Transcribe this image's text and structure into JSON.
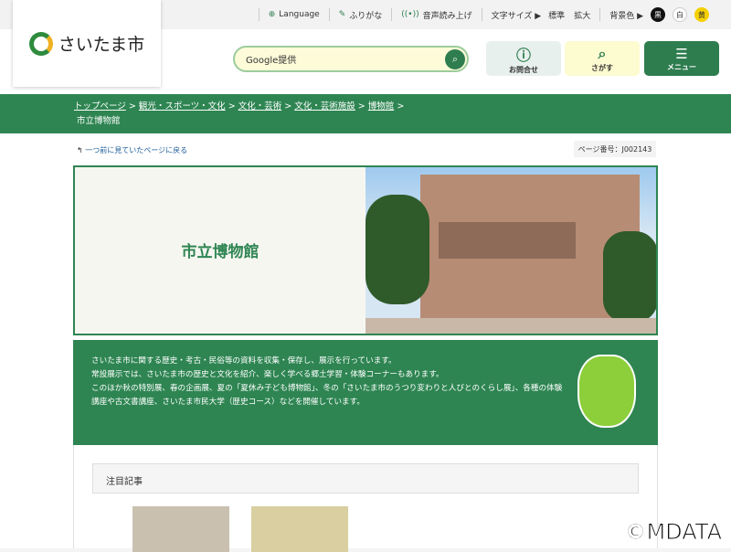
{
  "topbar": {
    "language": "Language",
    "furigana": "ふりがな",
    "speech": "音声読み上げ",
    "font_size_label": "文字サイズ ▶",
    "font_standard": "標準",
    "font_large": "拡大",
    "bg_label": "背景色 ▶",
    "bg_black": "黒",
    "bg_white": "白",
    "bg_yellow": "黄"
  },
  "header": {
    "logo_text": "さいたま市",
    "search_placeholder": "Google提供",
    "contact": "お問合せ",
    "search": "さがす",
    "menu": "メニュー"
  },
  "breadcrumb": {
    "items": [
      "トップページ",
      "観光・スポーツ・文化",
      "文化・芸術",
      "文化・芸術施設",
      "博物館"
    ],
    "current": "市立博物館",
    "sep": ">"
  },
  "page": {
    "back_link": "一つ前に見ていたページに戻る",
    "page_number": "ページ番号：J002143",
    "title": "市立博物館",
    "description": [
      "さいたま市に関する歴史・考古・民俗等の資料を収集・保存し、展示を行っています。",
      "常設展示では、さいたま市の歴史と文化を紹介、楽しく学べる郷土学習・体験コーナーもあります。",
      "このほか秋の特別展、春の企画展、夏の「夏休み子ども博物館」、冬の「さいたま市のうつり変わりと人びとのくらし展」、各種の体験講座や古文書講座、さいたま市民大学（歴史コース）などを開催しています。"
    ],
    "featured_heading": "注目記事"
  },
  "watermark": "©MDATA"
}
